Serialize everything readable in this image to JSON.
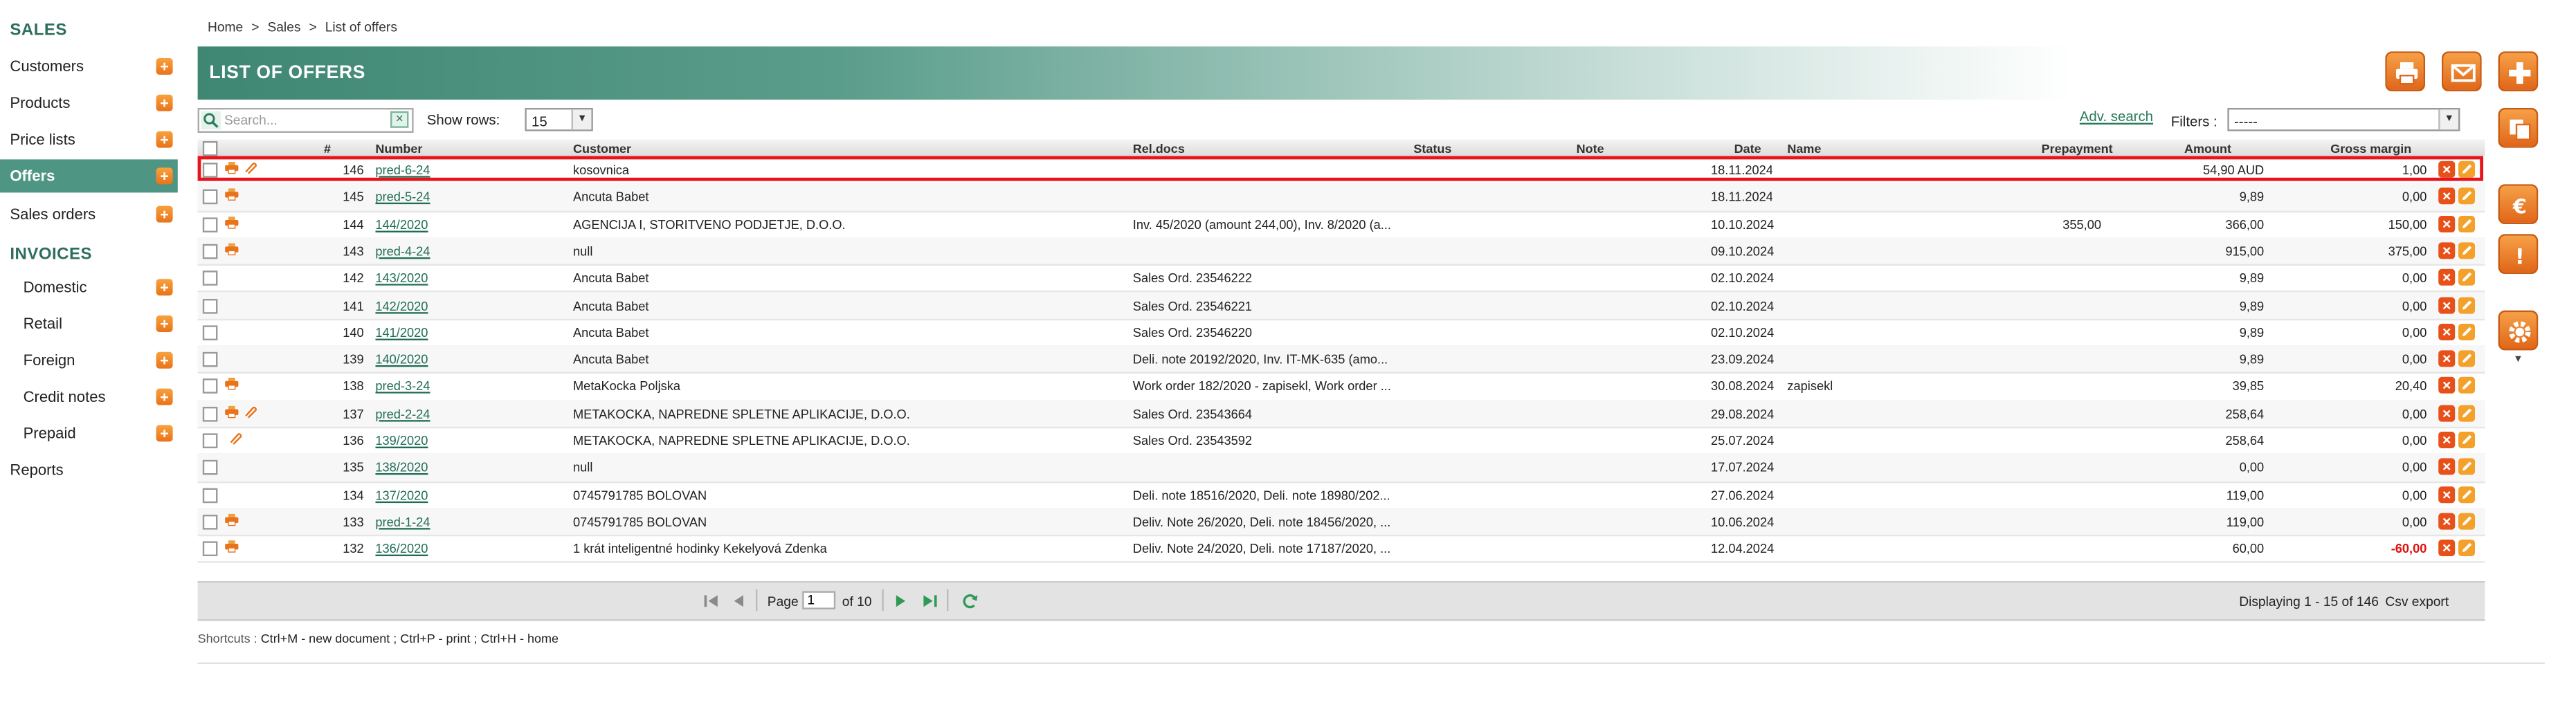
{
  "sidebar": {
    "sales_header": "SALES",
    "sales_items": [
      {
        "label": "Customers"
      },
      {
        "label": "Products"
      },
      {
        "label": "Price lists"
      },
      {
        "label": "Offers",
        "active": true
      },
      {
        "label": "Sales orders"
      }
    ],
    "invoices_header": "INVOICES",
    "invoice_items": [
      {
        "label": "Domestic"
      },
      {
        "label": "Retail"
      },
      {
        "label": "Foreign"
      },
      {
        "label": "Credit notes"
      },
      {
        "label": "Prepaid"
      }
    ],
    "reports_label": "Reports"
  },
  "breadcrumb": [
    "Home",
    "Sales",
    "List of offers"
  ],
  "breadcrumb_sep": ">",
  "page_title": "LIST OF OFFERS",
  "toolbar": {
    "search_placeholder": "Search...",
    "clear_label": "×",
    "show_rows_label": "Show rows:",
    "show_rows_value": "15",
    "adv_search_label": "Adv. search",
    "filters_label": "Filters :",
    "filters_value": "-----"
  },
  "columns": [
    "#",
    "Number",
    "Customer",
    "Rel.docs",
    "Status",
    "Note",
    "Date",
    "Name",
    "Prepayment",
    "Amount",
    "Gross margin"
  ],
  "rows": [
    {
      "id": "146",
      "number": "pred-6-24",
      "customer": "kosovnica",
      "reldocs": "",
      "date": "18.11.2024",
      "name": "",
      "prepayment": "",
      "amount": "54,90 AUD",
      "margin": "1,00",
      "printer": true,
      "attach": true
    },
    {
      "id": "145",
      "number": "pred-5-24",
      "customer": "Ancuta Babet",
      "reldocs": "",
      "date": "18.11.2024",
      "name": "",
      "prepayment": "",
      "amount": "9,89",
      "margin": "0,00",
      "printer": true,
      "attach": false
    },
    {
      "id": "144",
      "number": "144/2020",
      "customer": "AGENCIJA I, STORITVENO PODJETJE, D.O.O.",
      "reldocs": "Inv. 45/2020 (amount 244,00), Inv. 8/2020 (a...",
      "date": "10.10.2024",
      "name": "",
      "prepayment": "355,00",
      "amount": "366,00",
      "margin": "150,00",
      "printer": true,
      "attach": false
    },
    {
      "id": "143",
      "number": "pred-4-24",
      "customer": "null",
      "reldocs": "",
      "date": "09.10.2024",
      "name": "",
      "prepayment": "",
      "amount": "915,00",
      "margin": "375,00",
      "printer": true,
      "attach": false
    },
    {
      "id": "142",
      "number": "143/2020",
      "customer": "Ancuta Babet",
      "reldocs": "Sales Ord. 23546222",
      "date": "02.10.2024",
      "name": "",
      "prepayment": "",
      "amount": "9,89",
      "margin": "0,00",
      "printer": false,
      "attach": false
    },
    {
      "id": "141",
      "number": "142/2020",
      "customer": "Ancuta Babet",
      "reldocs": "Sales Ord. 23546221",
      "date": "02.10.2024",
      "name": "",
      "prepayment": "",
      "amount": "9,89",
      "margin": "0,00",
      "printer": false,
      "attach": false
    },
    {
      "id": "140",
      "number": "141/2020",
      "customer": "Ancuta Babet",
      "reldocs": "Sales Ord. 23546220",
      "date": "02.10.2024",
      "name": "",
      "prepayment": "",
      "amount": "9,89",
      "margin": "0,00",
      "printer": false,
      "attach": false
    },
    {
      "id": "139",
      "number": "140/2020",
      "customer": "Ancuta Babet",
      "reldocs": "Deli. note 20192/2020, Inv. IT-MK-635 (amo...",
      "date": "23.09.2024",
      "name": "",
      "prepayment": "",
      "amount": "9,89",
      "margin": "0,00",
      "printer": false,
      "attach": false
    },
    {
      "id": "138",
      "number": "pred-3-24",
      "customer": "MetaKocka Poljska",
      "reldocs": "Work order 182/2020 - zapisekl, Work order ...",
      "date": "30.08.2024",
      "name": "zapisekl",
      "prepayment": "",
      "amount": "39,85",
      "margin": "20,40",
      "printer": true,
      "attach": false
    },
    {
      "id": "137",
      "number": "pred-2-24",
      "customer": "METAKOCKA, NAPREDNE SPLETNE APLIKACIJE, D.O.O.",
      "reldocs": "Sales Ord. 23543664",
      "date": "29.08.2024",
      "name": "",
      "prepayment": "",
      "amount": "258,64",
      "margin": "0,00",
      "printer": true,
      "attach": true
    },
    {
      "id": "136",
      "number": "139/2020",
      "customer": "METAKOCKA, NAPREDNE SPLETNE APLIKACIJE, D.O.O.",
      "reldocs": "Sales Ord. 23543592",
      "date": "25.07.2024",
      "name": "",
      "prepayment": "",
      "amount": "258,64",
      "margin": "0,00",
      "printer": false,
      "attach": true
    },
    {
      "id": "135",
      "number": "138/2020",
      "customer": "null",
      "reldocs": "",
      "date": "17.07.2024",
      "name": "",
      "prepayment": "",
      "amount": "0,00",
      "margin": "0,00",
      "printer": false,
      "attach": false
    },
    {
      "id": "134",
      "number": "137/2020",
      "customer": "0745791785 BOLOVAN",
      "reldocs": "Deli. note 18516/2020, Deli. note 18980/202...",
      "date": "27.06.2024",
      "name": "",
      "prepayment": "",
      "amount": "119,00",
      "margin": "0,00",
      "printer": false,
      "attach": false
    },
    {
      "id": "133",
      "number": "pred-1-24",
      "customer": "0745791785 BOLOVAN",
      "reldocs": "Deliv. Note 26/2020, Deli. note 18456/2020, ...",
      "date": "10.06.2024",
      "name": "",
      "prepayment": "",
      "amount": "119,00",
      "margin": "0,00",
      "printer": true,
      "attach": false
    },
    {
      "id": "132",
      "number": "136/2020",
      "customer": "1 krát inteligentné hodinky Kekelyová Zdenka",
      "reldocs": "Deliv. Note 24/2020, Deli. note 17187/2020, ...",
      "date": "12.04.2024",
      "name": "",
      "prepayment": "",
      "amount": "60,00",
      "margin": "-60,00",
      "printer": true,
      "attach": false,
      "negative": true
    }
  ],
  "pager": {
    "page_label": "Page",
    "page_value": "1",
    "of_label": "of 10",
    "displaying": "Displaying 1 - 15 of 146",
    "csv_export": "Csv export"
  },
  "shortcuts": {
    "label": "Shortcuts :",
    "items": [
      "Ctrl+M - new document ;",
      "Ctrl+P - print ;",
      "Ctrl+H - home"
    ]
  },
  "colors": {
    "brand_green": "#4e9683",
    "accent_orange": "#e9731a",
    "highlight_red": "#e8141c",
    "negative_red": "#e01010"
  },
  "icons": [
    "print-icon",
    "mail-icon",
    "add-icon",
    "copy-icon",
    "euro-icon",
    "warning-icon",
    "settings-icon",
    "search-icon",
    "attachment-icon",
    "delete-icon",
    "edit-icon",
    "refresh-icon"
  ]
}
